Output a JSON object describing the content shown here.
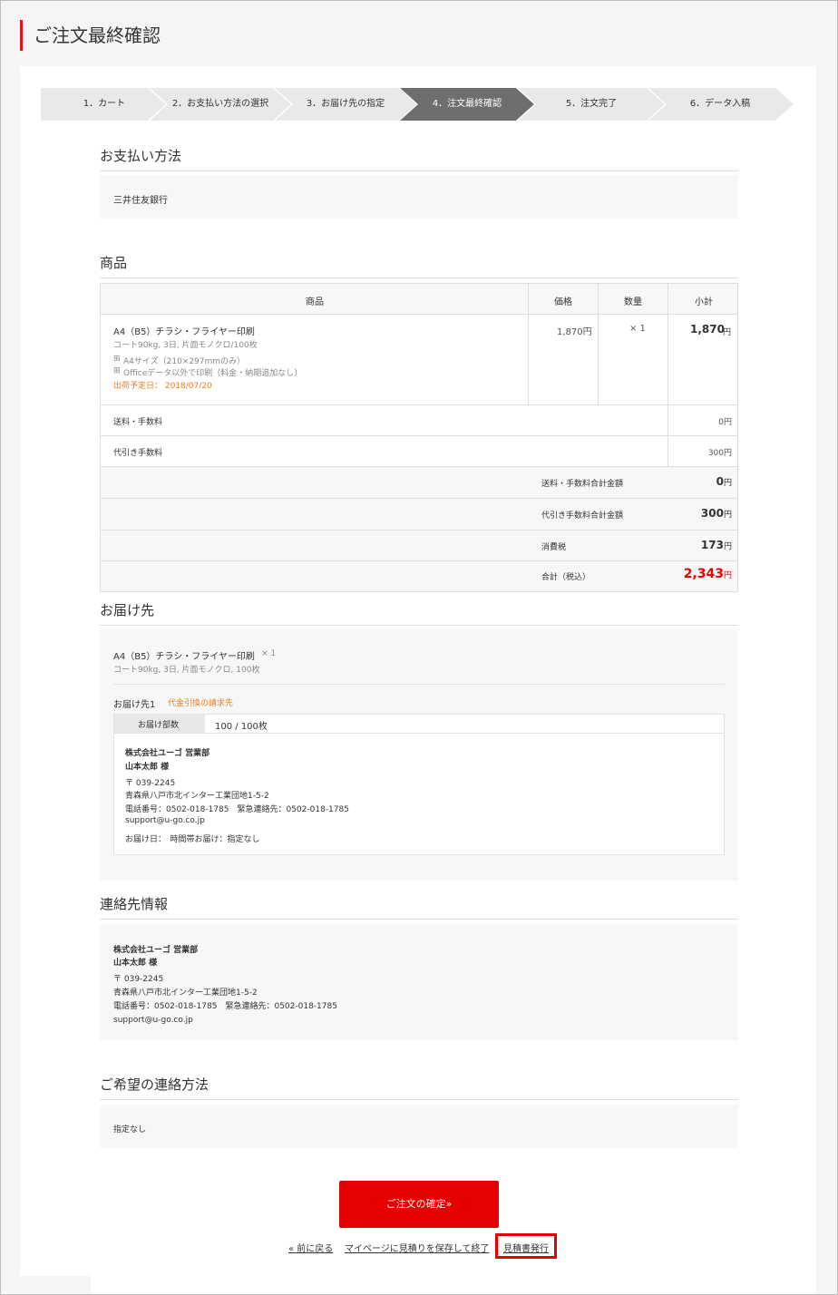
{
  "page": {
    "title": "ご注文最終確認"
  },
  "steps": [
    {
      "label": "1．カート"
    },
    {
      "label": "2．お支払い方法の選択"
    },
    {
      "label": "3．お届け先の指定"
    },
    {
      "label": "4．注文最終確認"
    },
    {
      "label": "5．注文完了"
    },
    {
      "label": "6．データ入稿"
    }
  ],
  "payment": {
    "title": "お支払い方法",
    "method": "三井住友銀行"
  },
  "products": {
    "title": "商品",
    "headers": {
      "product": "商品",
      "price": "価格",
      "qty": "数量",
      "subtotal": "小計"
    },
    "item": {
      "name": "A4（B5）チラシ・フライヤー印刷",
      "spec": "コート90kg, 3日, 片面モノクロ/100枚",
      "option1": "A4サイズ（210×297mmのみ）",
      "option2": "Officeデータ以外で印刷（料金・納期追加なし）",
      "ship_date": "出荷予定日： 2018/07/20",
      "price": "1,870円",
      "qty": "× 1",
      "subtotal": "1,870",
      "subtotal_unit": "円"
    },
    "fees": [
      {
        "label": "送料・手数料",
        "value": "0円"
      },
      {
        "label": "代引き手数料",
        "value": "300円"
      }
    ],
    "totals": [
      {
        "label": "送料・手数料合計金額",
        "value": "0",
        "unit": "円"
      },
      {
        "label": "代引き手数料合計金額",
        "value": "300",
        "unit": "円"
      },
      {
        "label": "消費税",
        "value": "173",
        "unit": "円"
      },
      {
        "label": "合計（税込）",
        "value": "2,343",
        "unit": "円"
      }
    ]
  },
  "delivery": {
    "title": "お届け先",
    "item_name": "A4（B5）チラシ・フライヤー印刷",
    "item_qty": "× 1",
    "item_spec": "コート90kg, 3日, 片面モノクロ, 100枚",
    "dest_label": "お届け先1",
    "dest_note": "代金引換の請求先",
    "count_label": "お届け部数",
    "count_value": "100 / 100枚",
    "company": "株式会社ユーゴ 営業部",
    "person": "山本太郎 様",
    "zip": "〒 039-2245",
    "address": "青森県八戸市北インター工業団地1-5-2",
    "phone": "電話番号：0502-018-1785　緊急連絡先：0502-018-1785",
    "email": "support@u-go.co.jp",
    "date": "お届け日：　時間帯お届け：指定なし"
  },
  "contact": {
    "title": "連絡先情報",
    "company": "株式会社ユーゴ 営業部",
    "person": "山本太郎 様",
    "zip": "〒 039-2245",
    "address": "青森県八戸市北インター工業団地1-5-2",
    "phone": "電話番号：0502-018-1785　緊急連絡先：0502-018-1785",
    "email": "support@u-go.co.jp"
  },
  "preferred_contact": {
    "title": "ご希望の連絡方法",
    "value": "指定なし"
  },
  "actions": {
    "confirm": "ご注文の確定»",
    "back": "« 前に戻る",
    "save": "マイページに見積りを保存して終了",
    "estimate": "見積書発行"
  },
  "colors": {
    "accent": "#e60000",
    "orange": "#e67e22",
    "step_active": "#6e6e6e"
  }
}
